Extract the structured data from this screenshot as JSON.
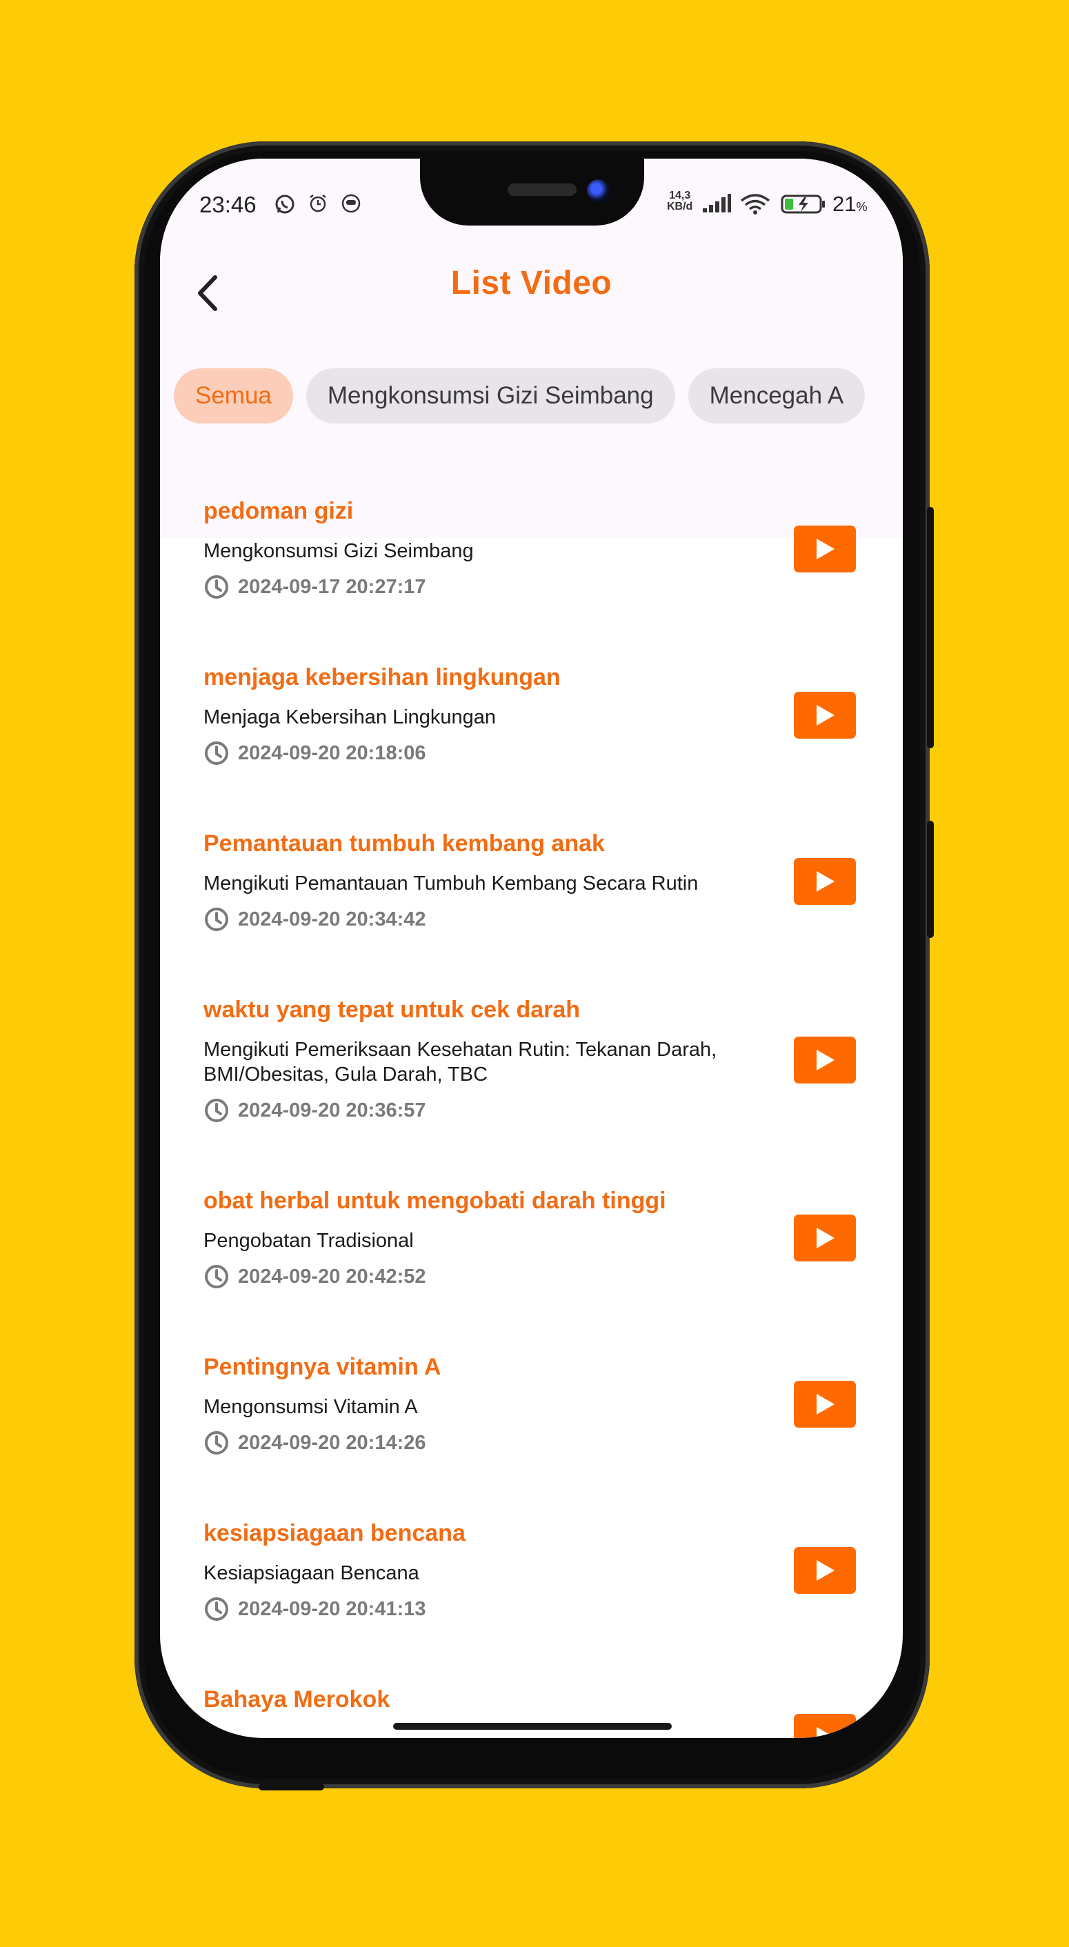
{
  "status_bar": {
    "time": "23:46",
    "net_speed_value": "14,3",
    "net_speed_unit": "KB/d",
    "battery_percent": "21",
    "battery_unit": "%"
  },
  "header": {
    "title": "List Video",
    "back_icon": "chevron-left-icon"
  },
  "filters": [
    {
      "label": "Semua",
      "active": true
    },
    {
      "label": "Mengkonsumsi Gizi Seimbang",
      "active": false
    },
    {
      "label": "Mencegah A",
      "active": false
    }
  ],
  "videos": [
    {
      "title": "pedoman gizi",
      "category": "Mengkonsumsi Gizi Seimbang",
      "date": "2024-09-17 20:27:17"
    },
    {
      "title": "menjaga kebersihan lingkungan",
      "category": "Menjaga Kebersihan Lingkungan",
      "date": "2024-09-20 20:18:06"
    },
    {
      "title": "Pemantauan tumbuh kembang anak",
      "category": "Mengikuti Pemantauan Tumbuh Kembang Secara Rutin",
      "date": "2024-09-20 20:34:42"
    },
    {
      "title": "waktu yang tepat untuk cek darah",
      "category": "Mengikuti Pemeriksaan Kesehatan Rutin: Tekanan Darah, BMI/Obesitas, Gula Darah, TBC",
      "date": "2024-09-20 20:36:57"
    },
    {
      "title": "obat herbal untuk mengobati darah tinggi",
      "category": "Pengobatan Tradisional",
      "date": "2024-09-20 20:42:52"
    },
    {
      "title": "Pentingnya vitamin A",
      "category": "Mengonsumsi Vitamin A",
      "date": "2024-09-20 20:14:26"
    },
    {
      "title": "kesiapsiagaan bencana",
      "category": "Kesiapsiagaan Bencana",
      "date": "2024-09-20 20:41:13"
    },
    {
      "title": "Bahaya Merokok",
      "category": "",
      "date": ""
    }
  ],
  "colors": {
    "background": "#FDCC06",
    "accent": "#F26C13",
    "play_button": "#FF6A00",
    "chip_active_bg": "#FCCDB8",
    "chip_bg": "#E8E4EA"
  },
  "icons": {
    "play": "play-icon",
    "clock": "clock-icon"
  }
}
